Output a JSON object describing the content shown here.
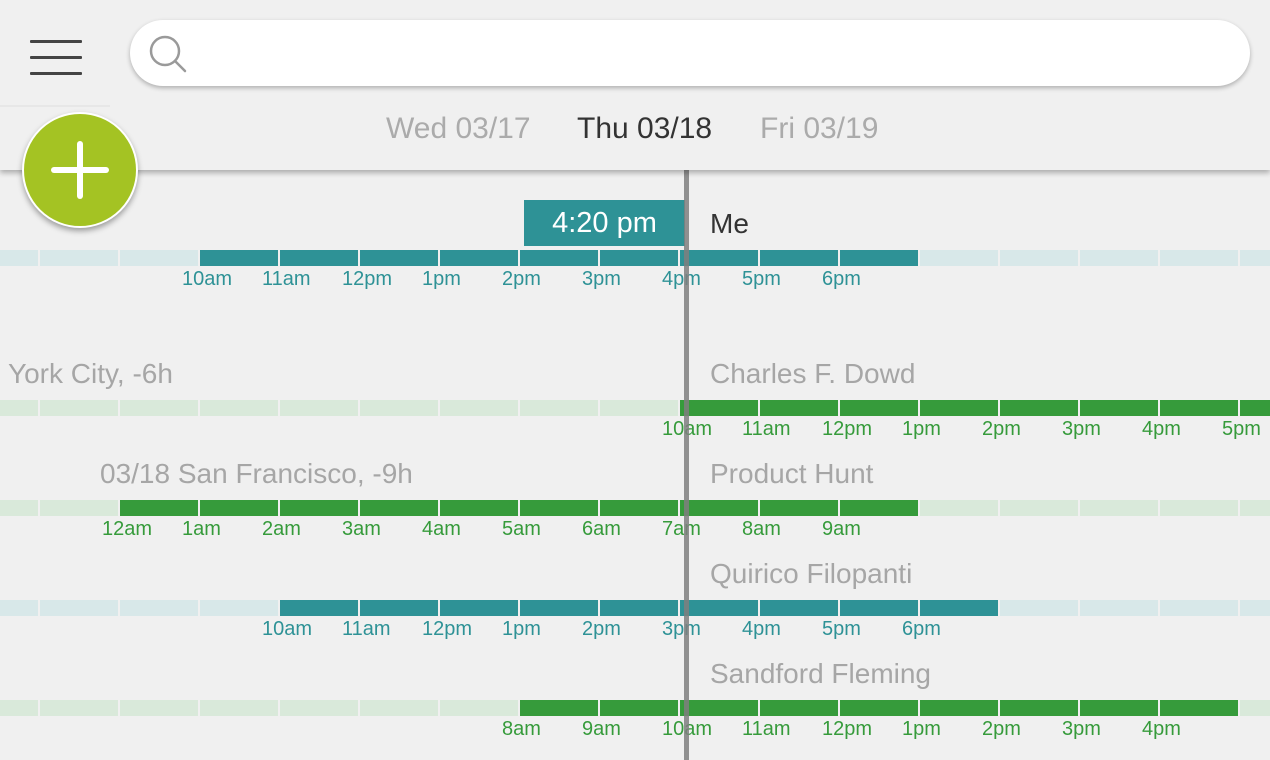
{
  "search": {
    "placeholder": "",
    "value": ""
  },
  "dates": [
    {
      "label": "Wed 03/17",
      "active": false
    },
    {
      "label": "Thu 03/18",
      "active": true
    },
    {
      "label": "Fri 03/19",
      "active": false
    }
  ],
  "current_time": "4:20 pm",
  "colors": {
    "teal": "#2e9296",
    "teal_light": "#d8e8e9",
    "green": "#369b3b",
    "green_light": "#d9e9da",
    "fab": "#a4c323",
    "now_line": "#7f7f7f"
  },
  "timezones": [
    {
      "left_label": "",
      "right_label": "Me",
      "color": "teal",
      "ticks": [
        "10am",
        "11am",
        "12pm",
        "1pm",
        "2pm",
        "3pm",
        "4pm",
        "5pm",
        "6pm"
      ]
    },
    {
      "left_label": "York City, -6h",
      "right_label": "Charles F. Dowd",
      "color": "green",
      "ticks": [
        "10am",
        "11am",
        "12pm",
        "1pm",
        "2pm",
        "3pm",
        "4pm",
        "5pm"
      ]
    },
    {
      "left_label": "03/18 San Francisco, -9h",
      "right_label": "Product Hunt",
      "color": "green",
      "ticks": [
        "12am",
        "1am",
        "2am",
        "3am",
        "4am",
        "5am",
        "6am",
        "7am",
        "8am",
        "9am"
      ]
    },
    {
      "left_label": "",
      "right_label": "Quirico Filopanti",
      "color": "teal",
      "ticks": [
        "10am",
        "11am",
        "12pm",
        "1pm",
        "2pm",
        "3pm",
        "4pm",
        "5pm",
        "6pm"
      ]
    },
    {
      "left_label": "",
      "right_label": "Sandford Fleming",
      "color": "green",
      "ticks": [
        "8am",
        "9am",
        "10am",
        "11am",
        "12pm",
        "1pm",
        "2pm",
        "3pm",
        "4pm"
      ]
    }
  ]
}
